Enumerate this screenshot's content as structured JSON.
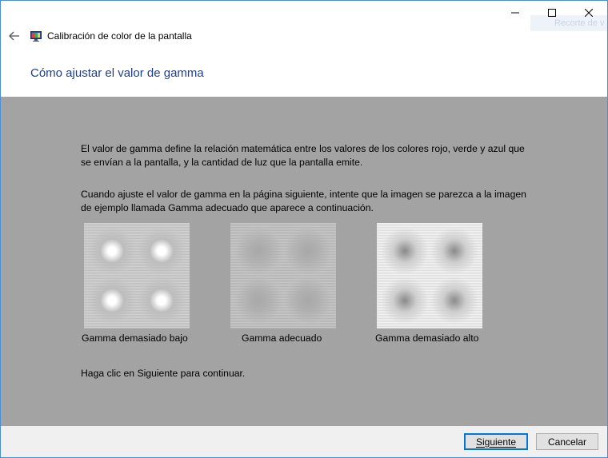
{
  "window": {
    "app_title": "Calibración de color de la pantalla",
    "tooltip_text": "Recorte de v"
  },
  "page": {
    "title": "Cómo ajustar el valor de gamma",
    "intro": "El valor de gamma define la relación matemática entre los valores de los colores rojo, verde y azul que se envían a la pantalla, y la cantidad de luz que la pantalla emite.",
    "instruction": "Cuando ajuste el valor de gamma en la página siguiente, intente que la imagen se parezca a la imagen de ejemplo llamada Gamma adecuado que aparece a continuación.",
    "samples": [
      {
        "caption": "Gamma demasiado bajo"
      },
      {
        "caption": "Gamma adecuado"
      },
      {
        "caption": "Gamma demasiado alto"
      }
    ],
    "continue_text": "Haga clic en Siguiente para continuar."
  },
  "footer": {
    "next_label": "Siguiente",
    "cancel_label": "Cancelar"
  },
  "colors": {
    "content_bg": "#a3a3a3",
    "title_blue": "#1e3f8f",
    "accent": "#0078d7"
  },
  "icons": {
    "back": "back-arrow-icon",
    "app": "display-color-icon",
    "minimize": "minimize-icon",
    "maximize": "maximize-icon",
    "close": "close-icon"
  }
}
